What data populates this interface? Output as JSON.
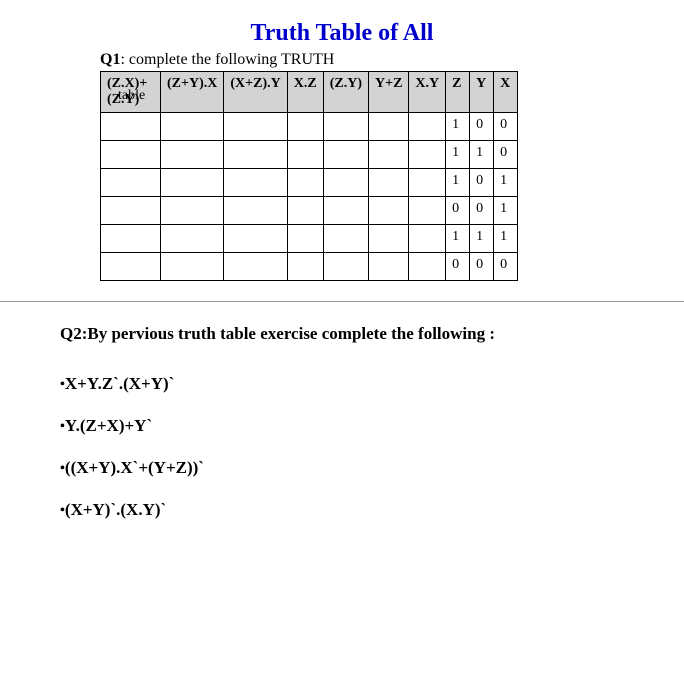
{
  "title": "Truth Table of All",
  "q1": {
    "prefix": "Q1",
    "text": ": complete the following TRUTH",
    "note": "table"
  },
  "headers": {
    "c0": "(Z.X)+(Z.Y)",
    "c1": "(Z+Y).X",
    "c2": "(X+Z).Y",
    "c3": "X.Z",
    "c4": "(Z.Y)",
    "c5": "Y+Z",
    "c6": "X.Y",
    "c7": "Z",
    "c8": "Y",
    "c9": "X"
  },
  "rows": [
    {
      "z": "1",
      "y": "0",
      "x": "0"
    },
    {
      "z": "1",
      "y": "1",
      "x": "0"
    },
    {
      "z": "1",
      "y": "0",
      "x": "1"
    },
    {
      "z": "0",
      "y": "0",
      "x": "1"
    },
    {
      "z": "1",
      "y": "1",
      "x": "1"
    },
    {
      "z": "0",
      "y": "0",
      "x": "0"
    }
  ],
  "q2": "Q2:By pervious truth table exercise complete the following :",
  "expressions": {
    "e0": "X+Y.Z`.(X+Y)`",
    "e1": "Y.(Z+X)+Y`",
    "e2": "((X+Y).X`+(Y+Z))`",
    "e3": "(X+Y)`.(X.Y)`"
  }
}
